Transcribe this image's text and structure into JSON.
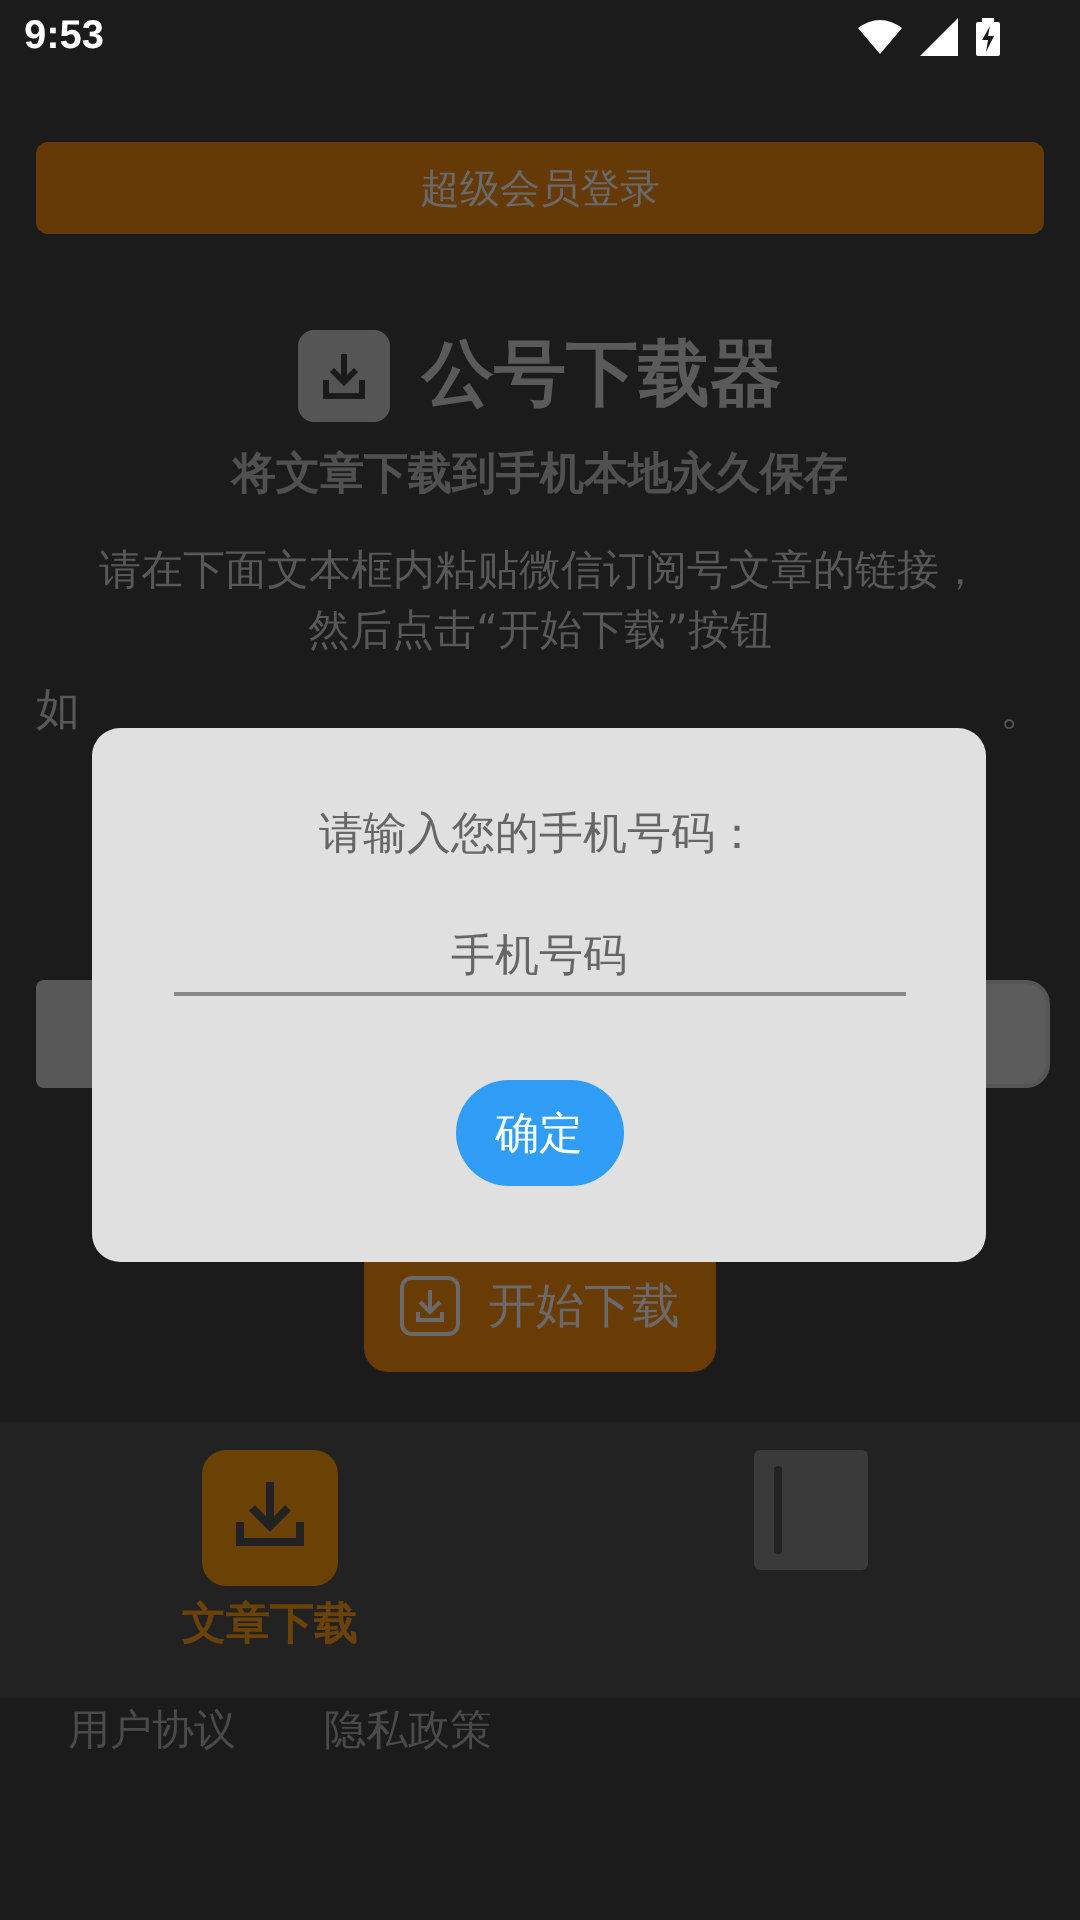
{
  "status_bar": {
    "time": "9:53"
  },
  "member_login_button": {
    "label": "超级会员登录"
  },
  "app_title": "公号下载器",
  "subtitle": "将文章下载到手机本地永久保存",
  "instructions": [
    "请在下面文本框内粘贴微信订阅号文章的链接，",
    "然后点击“开始下载”按钮"
  ],
  "instruction_fragments": [
    "如",
    "。"
  ],
  "start_button": {
    "label": "开始下载"
  },
  "dialog": {
    "title": "请输入您的手机号码：",
    "phone_field": {
      "placeholder": "手机号码"
    },
    "confirm_button": "确定"
  },
  "bottom_nav": [
    {
      "label": "文章下载",
      "kind": "download",
      "selected": true
    },
    {
      "kind": "book",
      "selected": false
    }
  ],
  "footer_links": [
    "用户协议",
    "隐私政策"
  ]
}
